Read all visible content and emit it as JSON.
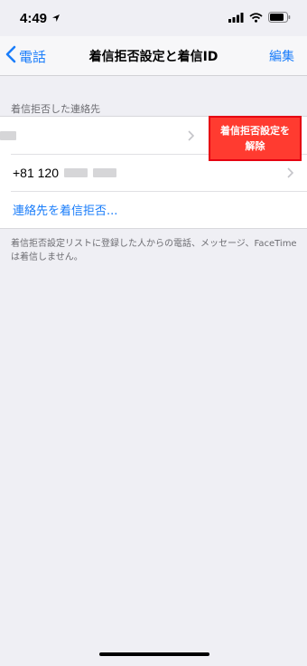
{
  "status_bar": {
    "time": "4:49",
    "icons": [
      "location-arrow-icon",
      "signal-icon",
      "wifi-icon",
      "battery-icon"
    ]
  },
  "nav": {
    "back_label": "電話",
    "title": "着信拒否設定と着信ID",
    "edit_label": "編集"
  },
  "section": {
    "header": "着信拒否した連絡先",
    "rows": [
      {
        "text": "",
        "redacted": true
      },
      {
        "text": "+81 120",
        "redacted_suffix": true
      }
    ],
    "unblock_action_label": "着信拒否設定を解除",
    "add_label": "連絡先を着信拒否..."
  },
  "footer_note": "着信拒否設定リストに登録した人からの電話、メッセージ、FaceTimeは着信しません。",
  "colors": {
    "accent": "#1a7dfa",
    "destructive": "#ff3b30",
    "highlight_border": "#e60012",
    "background": "#efeff4"
  }
}
